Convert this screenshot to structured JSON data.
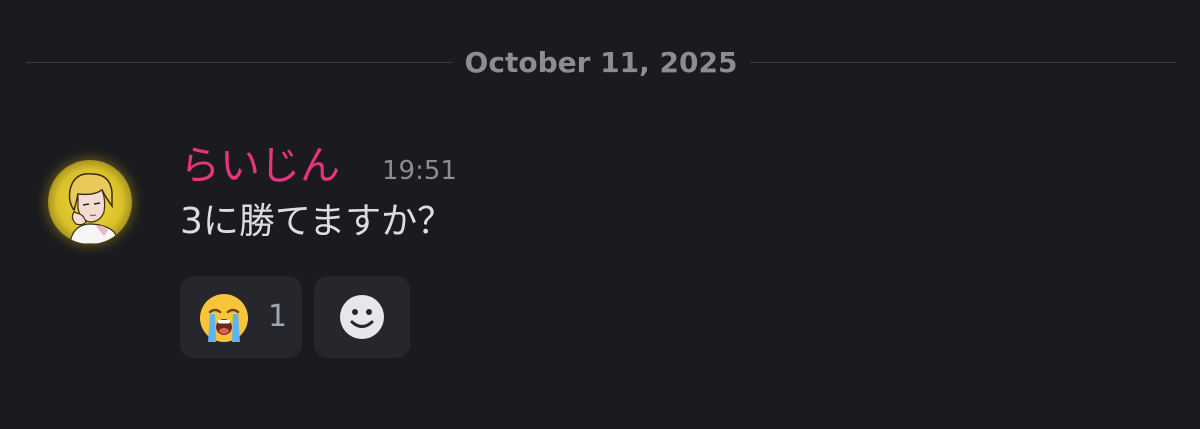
{
  "date_divider": {
    "label": "October 11, 2025"
  },
  "message": {
    "author": "らいじん",
    "author_color": "#e8337e",
    "timestamp": "19:51",
    "content": "3に勝てますか？",
    "avatar_icon": "user-avatar-icon"
  },
  "reactions": [
    {
      "emoji_name": "loudly-crying-face",
      "count": "1"
    }
  ],
  "add_reaction": {
    "icon": "smiley-face-icon"
  }
}
